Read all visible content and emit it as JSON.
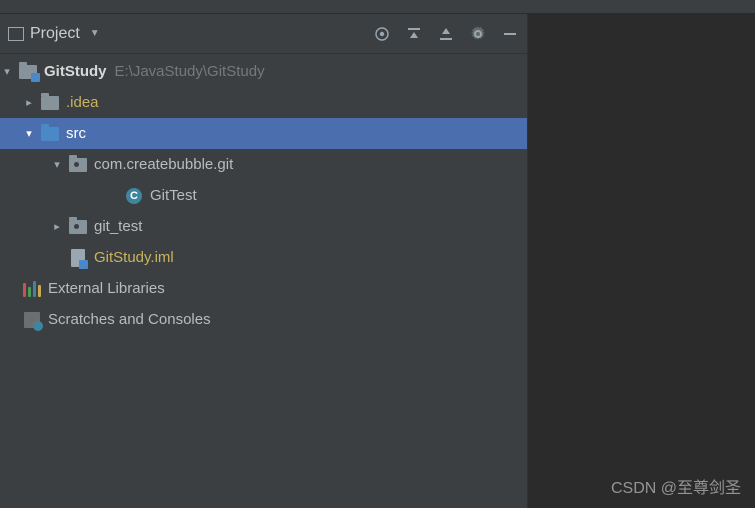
{
  "panel": {
    "title": "Project"
  },
  "tree": {
    "root": {
      "name": "GitStudy",
      "path": "E:\\JavaStudy\\GitStudy"
    },
    "idea": ".idea",
    "src": "src",
    "package": "com.createbubble.git",
    "class1": "GitTest",
    "git_test": "git_test",
    "iml": "GitStudy.iml",
    "external": "External Libraries",
    "scratches": "Scratches and Consoles"
  },
  "watermark": "CSDN @至尊剑圣"
}
